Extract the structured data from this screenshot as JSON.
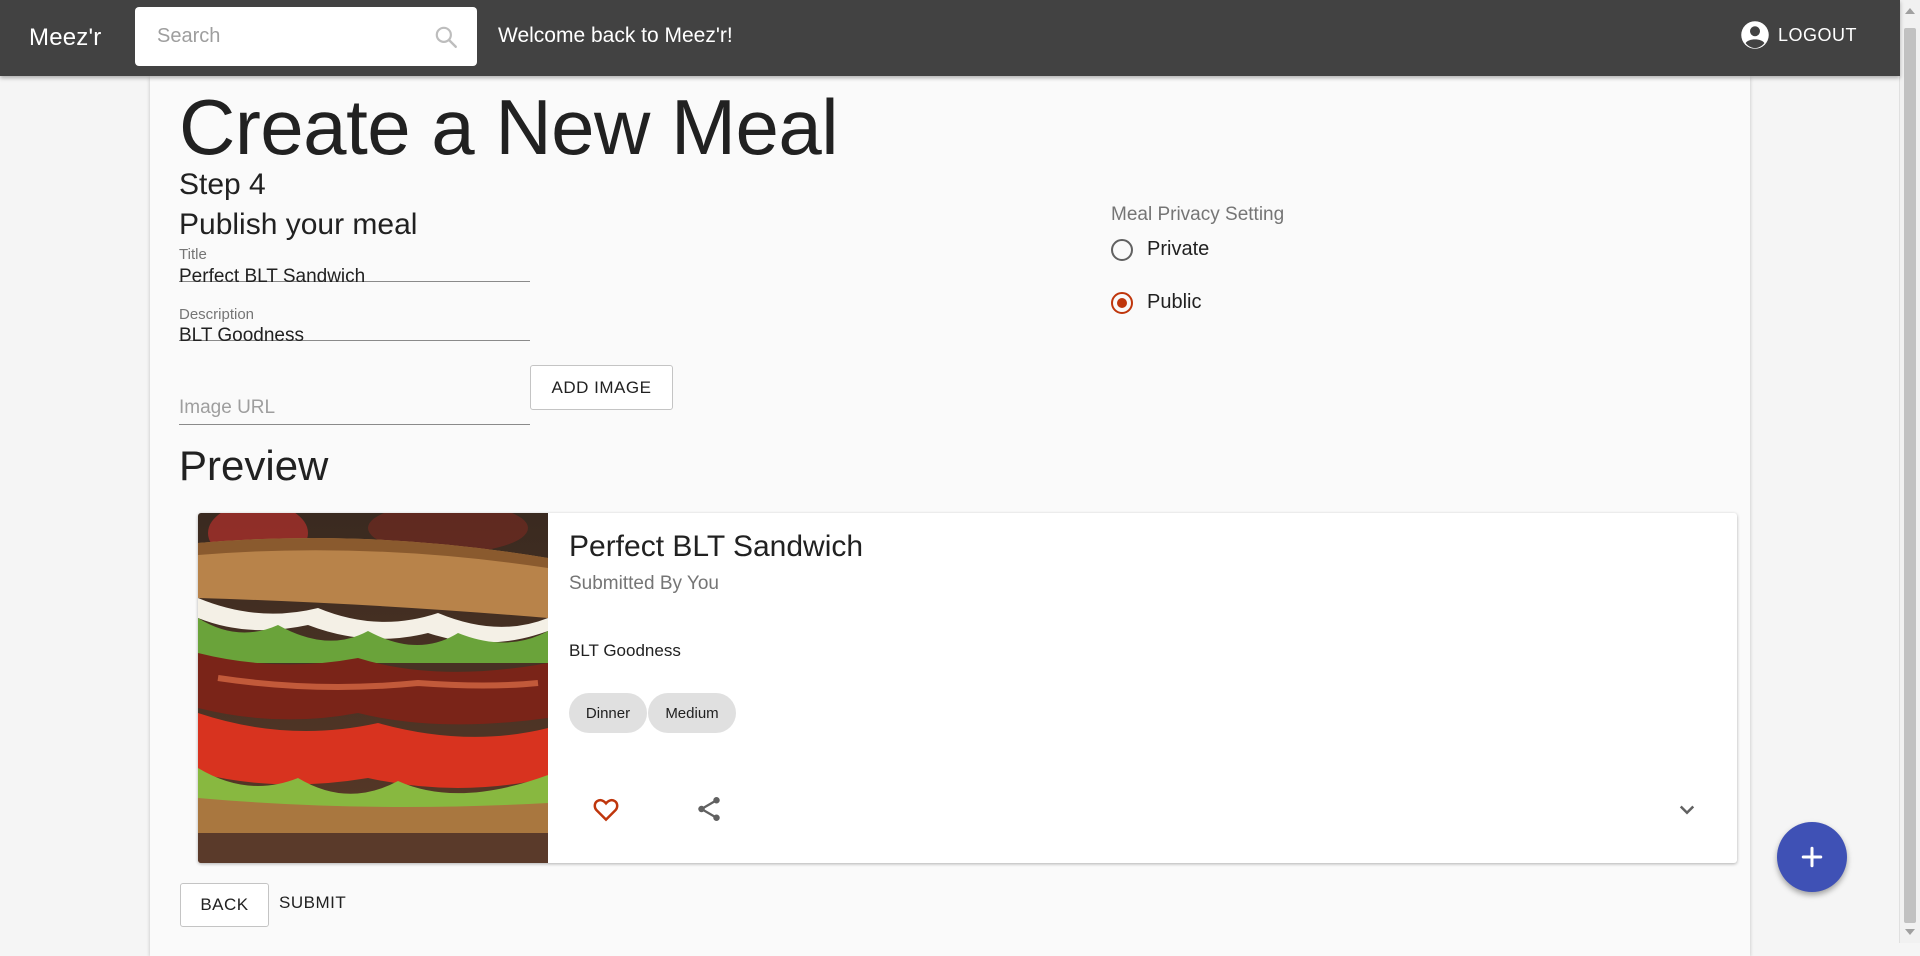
{
  "appbar": {
    "brand": "Meez'r",
    "search_placeholder": "Search",
    "welcome": "Welcome back to Meez'r!",
    "logout_label": "LOGOUT"
  },
  "page": {
    "title": "Create a New Meal",
    "step": "Step 4",
    "subtitle": "Publish your meal"
  },
  "form": {
    "title_label": "Title",
    "title_value": "Perfect BLT Sandwich",
    "description_label": "Description",
    "description_value": "BLT Goodness",
    "image_url_placeholder": "Image URL",
    "add_image_label": "ADD IMAGE"
  },
  "privacy": {
    "label": "Meal Privacy Setting",
    "options": [
      {
        "label": "Private",
        "selected": false
      },
      {
        "label": "Public",
        "selected": true
      }
    ]
  },
  "preview": {
    "heading": "Preview",
    "card": {
      "title": "Perfect BLT Sandwich",
      "submitted_by": "Submitted By You",
      "description": "BLT Goodness",
      "chips": [
        "Dinner",
        "Medium"
      ],
      "icons": [
        "heart-icon",
        "share-icon",
        "chevron-down-icon"
      ]
    }
  },
  "actions": {
    "back_label": "BACK",
    "submit_label": "SUBMIT"
  },
  "colors": {
    "appbar": "#424242",
    "accent": "#bf360c",
    "fab": "#3f51b5",
    "chip": "#e0e0e0"
  }
}
